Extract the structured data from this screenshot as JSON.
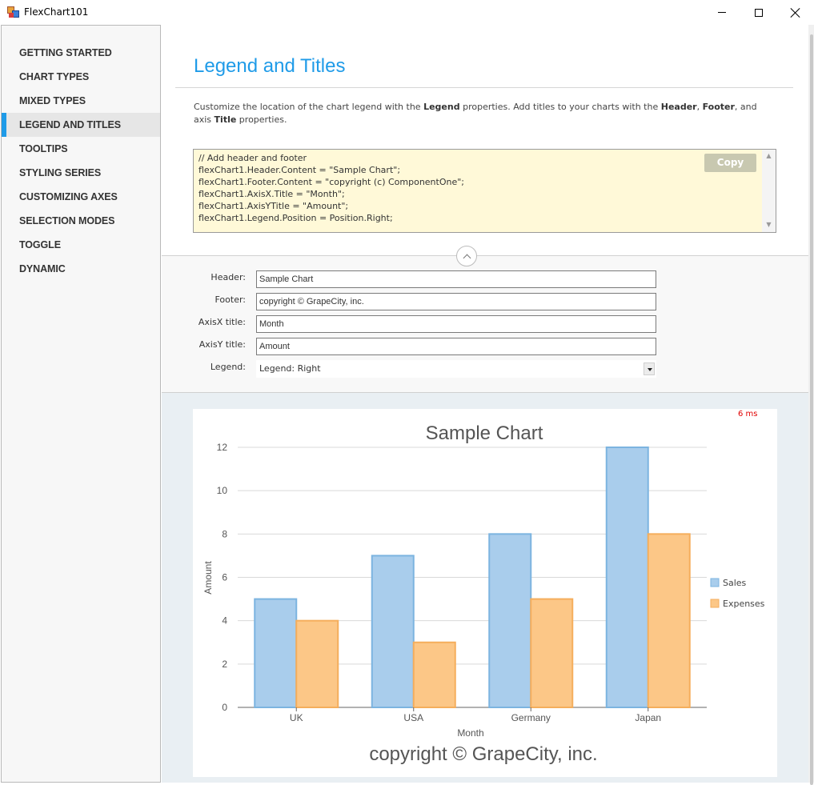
{
  "window": {
    "title": "FlexChart101"
  },
  "sidebar": {
    "items": [
      {
        "label": "GETTING STARTED"
      },
      {
        "label": "CHART TYPES"
      },
      {
        "label": "MIXED TYPES"
      },
      {
        "label": "LEGEND AND TITLES"
      },
      {
        "label": "TOOLTIPS"
      },
      {
        "label": "STYLING SERIES"
      },
      {
        "label": "CUSTOMIZING AXES"
      },
      {
        "label": "SELECTION MODES"
      },
      {
        "label": "TOGGLE"
      },
      {
        "label": "DYNAMIC"
      }
    ],
    "active_index": 3
  },
  "page": {
    "title": "Legend and Titles",
    "description": {
      "p1": "Customize the location of the chart legend with the ",
      "b1": "Legend",
      "p2": " properties. Add titles to your charts with the ",
      "b2": "Header",
      "p3": ", ",
      "b3": "Footer",
      "p4": ", and axis ",
      "b4": "Title",
      "p5": " properties."
    }
  },
  "code": {
    "lines": [
      "// Add header and footer",
      "flexChart1.Header.Content = \"Sample Chart\";",
      "flexChart1.Footer.Content = \"copyright (c) ComponentOne\";",
      "flexChart1.AxisX.Title = \"Month\";",
      "flexChart1.AxisYTitle = \"Amount\";",
      "flexChart1.Legend.Position = Position.Right;"
    ],
    "copy_label": "Copy"
  },
  "settings": {
    "header_label": "Header:",
    "header_value": "Sample Chart",
    "footer_label": "Footer:",
    "footer_value": "copyright © GrapeCity, inc.",
    "axisx_label": "AxisX title:",
    "axisx_value": "Month",
    "axisy_label": "AxisY title:",
    "axisy_value": "Amount",
    "legend_label": "Legend:",
    "legend_value": "Legend: Right"
  },
  "timing": "6 ms",
  "colors": {
    "accent": "#1f9be8",
    "sales_fill": "#a9cdec",
    "sales_stroke": "#7cb4e0",
    "expenses_fill": "#fcc787",
    "expenses_stroke": "#f5ae5c",
    "timing_text": "#e00000"
  },
  "chart_data": {
    "type": "bar",
    "title": "Sample Chart",
    "footer": "copyright © GrapeCity, inc.",
    "xlabel": "Month",
    "ylabel": "Amount",
    "categories": [
      "UK",
      "USA",
      "Germany",
      "Japan"
    ],
    "series": [
      {
        "name": "Sales",
        "values": [
          5,
          7,
          8,
          12
        ]
      },
      {
        "name": "Expenses",
        "values": [
          4,
          3,
          5,
          8
        ]
      }
    ],
    "ylim": [
      0,
      12
    ],
    "yticks": [
      0,
      2,
      4,
      6,
      8,
      10,
      12
    ],
    "grid": true,
    "legend_position": "right"
  }
}
